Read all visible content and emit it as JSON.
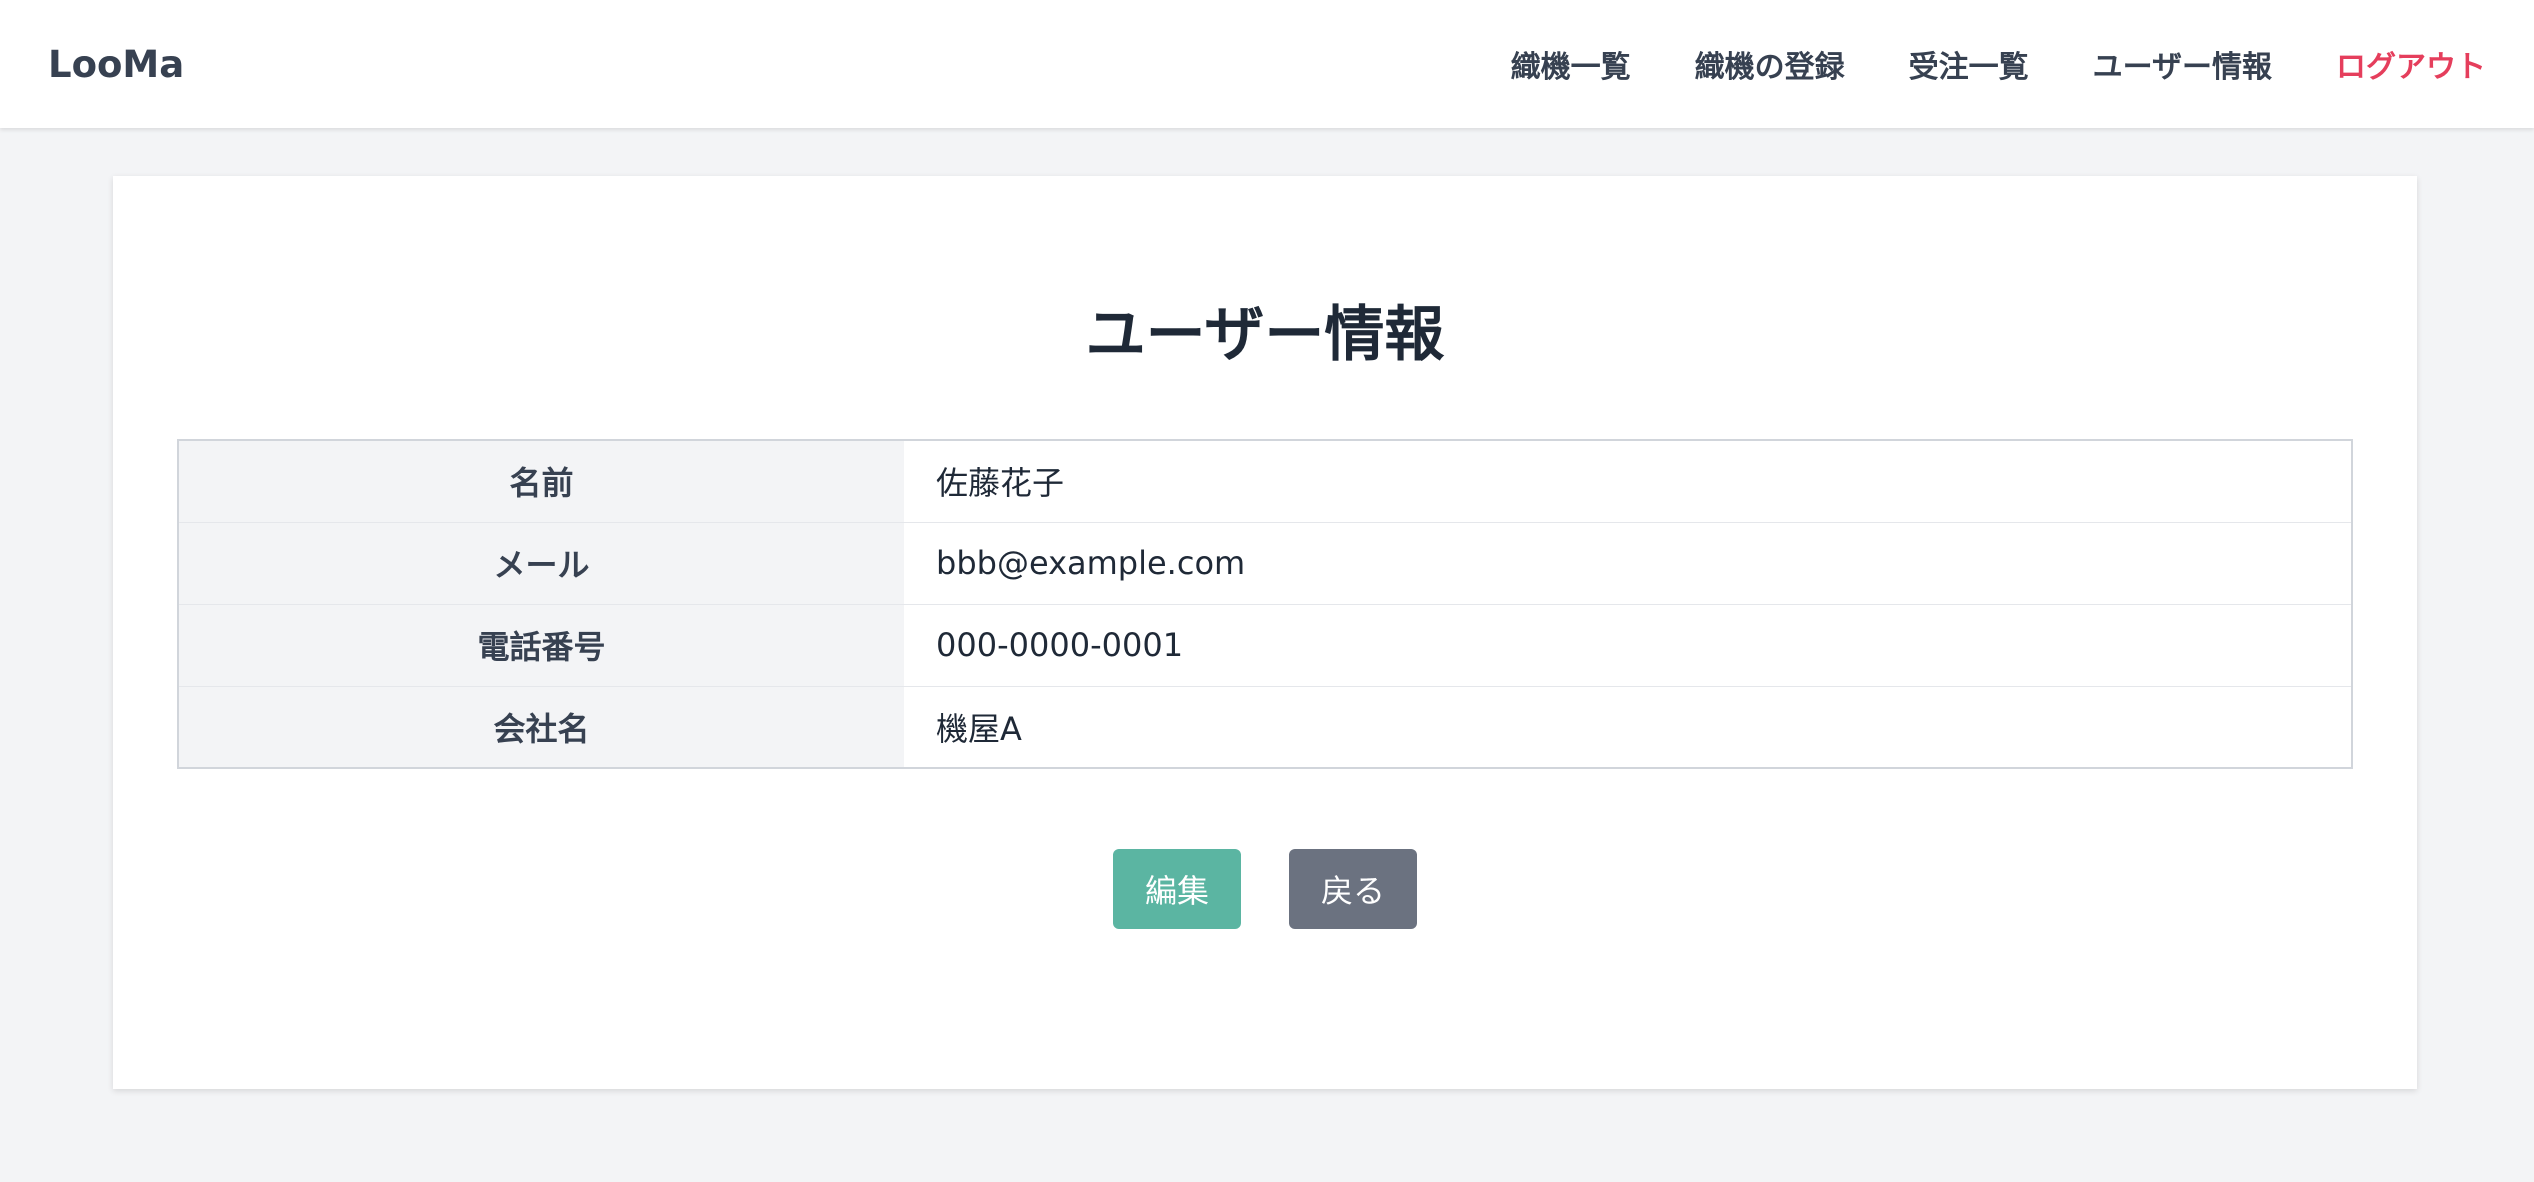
{
  "navbar": {
    "brand": "LooMa",
    "links": [
      {
        "label": "織機一覧"
      },
      {
        "label": "織機の登録"
      },
      {
        "label": "受注一覧"
      },
      {
        "label": "ユーザー情報"
      },
      {
        "label": "ログアウト"
      }
    ]
  },
  "page": {
    "title": "ユーザー情報"
  },
  "user_info": {
    "rows": [
      {
        "label": "名前",
        "value": "佐藤花子"
      },
      {
        "label": "メール",
        "value": "bbb@example.com"
      },
      {
        "label": "電話番号",
        "value": "000-0000-0001"
      },
      {
        "label": "会社名",
        "value": "機屋A"
      }
    ]
  },
  "actions": {
    "edit_label": "編集",
    "back_label": "戻る"
  },
  "colors": {
    "accent": "#5bb5a2",
    "logout": "#e53e5c",
    "secondary": "#6b7280"
  }
}
